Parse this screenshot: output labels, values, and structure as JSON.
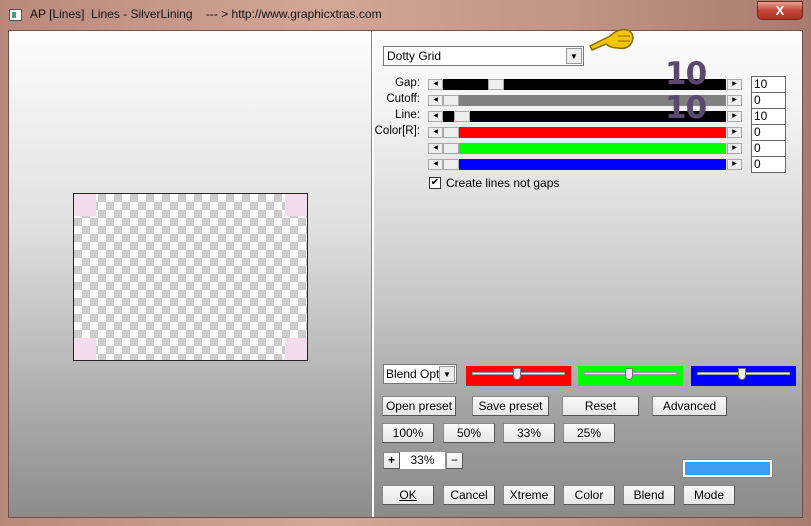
{
  "window": {
    "title": "AP [Lines]  Lines - SilverLining    --- > http://www.graphicxtras.com",
    "close_label": "X"
  },
  "preset": {
    "selected": "Dotty Grid"
  },
  "sliders": [
    {
      "label": "Gap:",
      "value": "10",
      "color": "#000000",
      "position": 0.17
    },
    {
      "label": "Cutoff:",
      "value": "0",
      "color": "#808080",
      "position": 0.0
    },
    {
      "label": "Line:",
      "value": "10",
      "color": "#000000",
      "position": 0.04
    },
    {
      "label": "Color[R]:",
      "value": "0",
      "color": "#ff0000",
      "position": 0.0
    },
    {
      "label": "",
      "value": "0",
      "color": "#00ff00",
      "position": 0.0
    },
    {
      "label": "",
      "value": "0",
      "color": "#0000ff",
      "position": 0.0
    }
  ],
  "watermarks": [
    "10",
    "10"
  ],
  "checkbox": {
    "label": "Create lines not gaps",
    "checked": true
  },
  "blend": {
    "selected": "Blend Optio",
    "sliders": [
      {
        "color": "#ff0000",
        "position": 0.5
      },
      {
        "color": "#00ff00",
        "position": 0.5
      },
      {
        "color": "#0000ff",
        "position": 0.5
      }
    ]
  },
  "buttons": {
    "open_preset": "Open preset",
    "save_preset": "Save preset",
    "reset": "Reset",
    "advanced": "Advanced",
    "z100": "100%",
    "z50": "50%",
    "z33": "33%",
    "z25": "25%",
    "plus": "+",
    "minus": "−",
    "ok": "OK",
    "cancel": "Cancel",
    "xtreme": "Xtreme",
    "color": "Color",
    "blend": "Blend",
    "mode": "Mode"
  },
  "zoom": {
    "value": "33%"
  },
  "swatch_color": "#3d9bf2"
}
